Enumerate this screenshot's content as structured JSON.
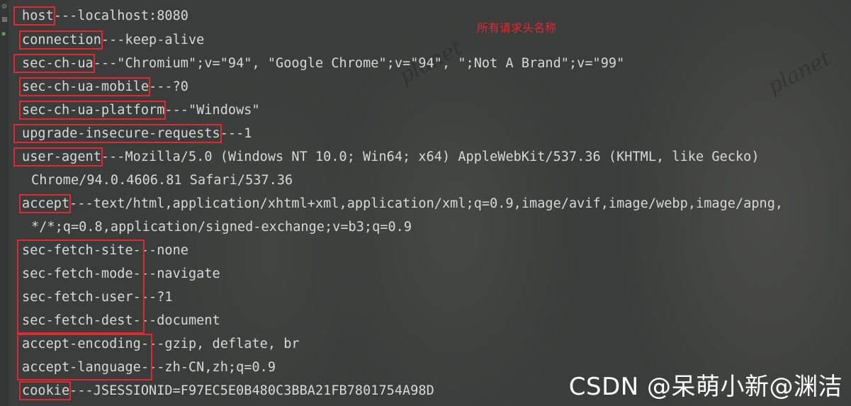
{
  "annotation": "所有请求头名称",
  "separator": "---",
  "headers": [
    {
      "name": "host",
      "value": "localhost:8080"
    },
    {
      "name": "connection",
      "value": "keep-alive"
    },
    {
      "name": "sec-ch-ua",
      "value": "\"Chromium\";v=\"94\", \"Google Chrome\";v=\"94\", \";Not A Brand\";v=\"99\""
    },
    {
      "name": "sec-ch-ua-mobile",
      "value": "?0"
    },
    {
      "name": "sec-ch-ua-platform",
      "value": "\"Windows\""
    },
    {
      "name": "upgrade-insecure-requests",
      "value": "1"
    },
    {
      "name": "user-agent",
      "value": "Mozilla/5.0 (Windows NT 10.0; Win64; x64) AppleWebKit/537.36 (KHTML, like Gecko)",
      "continuation": "Chrome/94.0.4606.81 Safari/537.36"
    },
    {
      "name": "accept",
      "value": "text/html,application/xhtml+xml,application/xml;q=0.9,image/avif,image/webp,image/apng,",
      "continuation": "*/*;q=0.8,application/signed-exchange;v=b3;q=0.9"
    },
    {
      "name": "sec-fetch-site",
      "value": "none"
    },
    {
      "name": "sec-fetch-mode",
      "value": "navigate"
    },
    {
      "name": "sec-fetch-user",
      "value": "?1"
    },
    {
      "name": "sec-fetch-dest",
      "value": "document"
    },
    {
      "name": "accept-encoding",
      "value": "gzip, deflate, br"
    },
    {
      "name": "accept-language",
      "value": "zh-CN,zh;q=0.9"
    },
    {
      "name": "cookie",
      "value": "JSESSIONID=F97EC5E0B480C3BBA21FB7801754A98D"
    }
  ],
  "watermark": "CSDN @呆萌小新@渊洁",
  "background_text": [
    "planet",
    "planet"
  ],
  "colors": {
    "highlight_box": "#e0282e",
    "text": "#d8d8d8",
    "background": "#3b3d3c"
  },
  "gutter_icons": [
    "gear-icon",
    "grid-icon",
    "run-icon"
  ]
}
